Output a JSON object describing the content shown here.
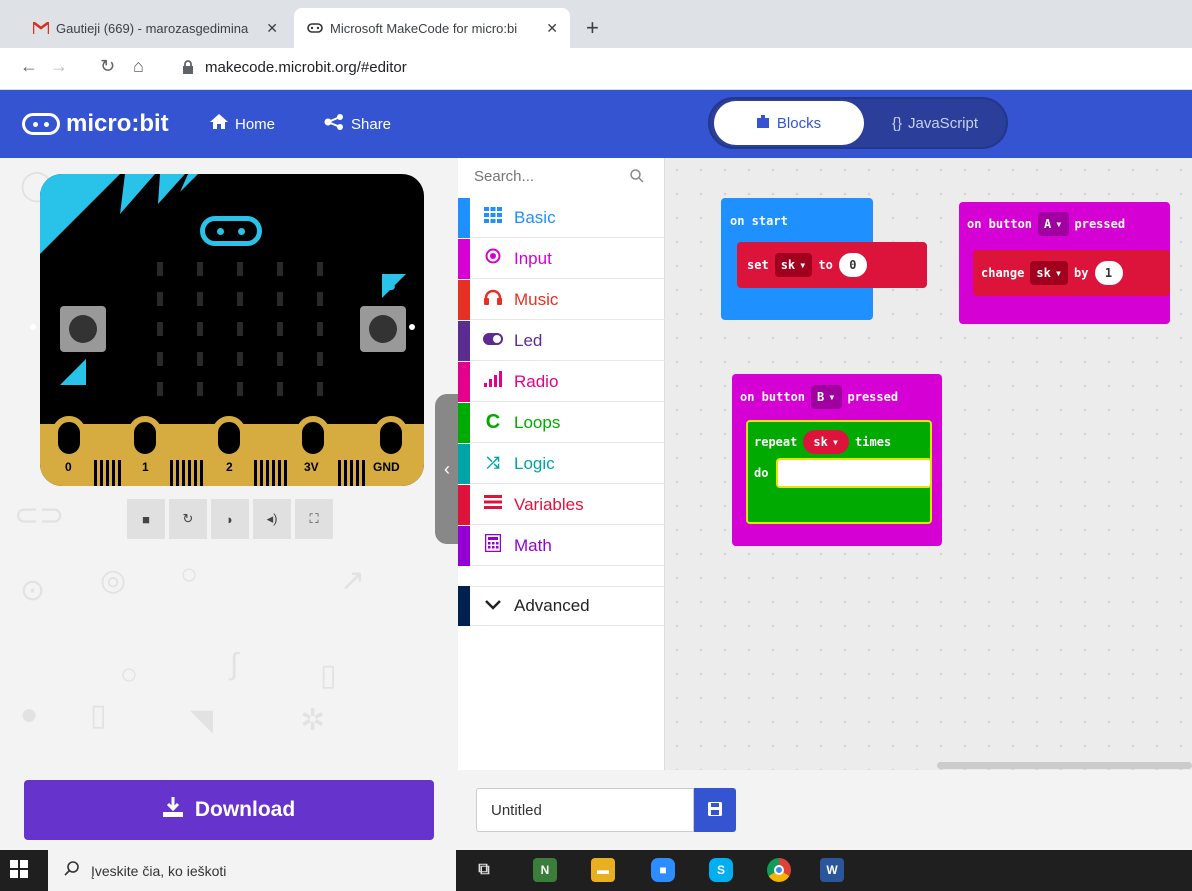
{
  "browser": {
    "tabs": [
      {
        "title": "Gautieji (669) - marozasgedimina",
        "close": "✕",
        "active": false,
        "icon": "gmail-icon"
      },
      {
        "title": "Microsoft MakeCode for micro:bi",
        "close": "✕",
        "active": true,
        "icon": "microbit-icon"
      }
    ],
    "new_tab": "+",
    "url": "makecode.microbit.org/#editor"
  },
  "header": {
    "logo": "micro:bit",
    "home": "Home",
    "share": "Share",
    "blocks": "Blocks",
    "javascript": "JavaScript"
  },
  "simulator": {
    "button_a": "A",
    "button_b": "B",
    "pins": [
      "0",
      "1",
      "2",
      "3V",
      "GND"
    ]
  },
  "toolbox": {
    "search_placeholder": "Search...",
    "categories": [
      {
        "label": "Basic",
        "color": "#1e90ff",
        "icon": "grid-icon"
      },
      {
        "label": "Input",
        "color": "#d400d4",
        "icon": "target-icon"
      },
      {
        "label": "Music",
        "color": "#e63022",
        "icon": "headphones-icon"
      },
      {
        "label": "Led",
        "color": "#5c2d91",
        "icon": "toggle-icon"
      },
      {
        "label": "Radio",
        "color": "#e3008c",
        "icon": "signal-icon"
      },
      {
        "label": "Loops",
        "color": "#00aa00",
        "icon": "loop-icon"
      },
      {
        "label": "Logic",
        "color": "#00a4a6",
        "icon": "shuffle-icon"
      },
      {
        "label": "Variables",
        "color": "#dc143c",
        "icon": "lines-icon"
      },
      {
        "label": "Math",
        "color": "#9400d3",
        "icon": "calculator-icon"
      },
      {
        "label": "Advanced",
        "color": "#002050",
        "icon": "chevron-down-icon"
      }
    ]
  },
  "workspace": {
    "on_start": {
      "label": "on start",
      "set": "set",
      "var": "sk",
      "to": "to",
      "value": "0"
    },
    "on_button_a": {
      "label": "on button",
      "button": "A",
      "pressed": "pressed",
      "change": "change",
      "var": "sk",
      "by": "by",
      "value": "1"
    },
    "on_button_b": {
      "label": "on button",
      "button": "B",
      "pressed": "pressed",
      "repeat": "repeat",
      "var": "sk",
      "times": "times",
      "do": "do"
    }
  },
  "bottom": {
    "download": "Download",
    "project_name": "Untitled"
  },
  "taskbar": {
    "search_placeholder": "Įveskite čia, ko ieškoti"
  },
  "colors": {
    "header": "#3454d1",
    "download": "#6633cc",
    "events": "#d400d4",
    "basic": "#1e90ff",
    "variables": "#dc143c",
    "loops": "#00aa00"
  }
}
